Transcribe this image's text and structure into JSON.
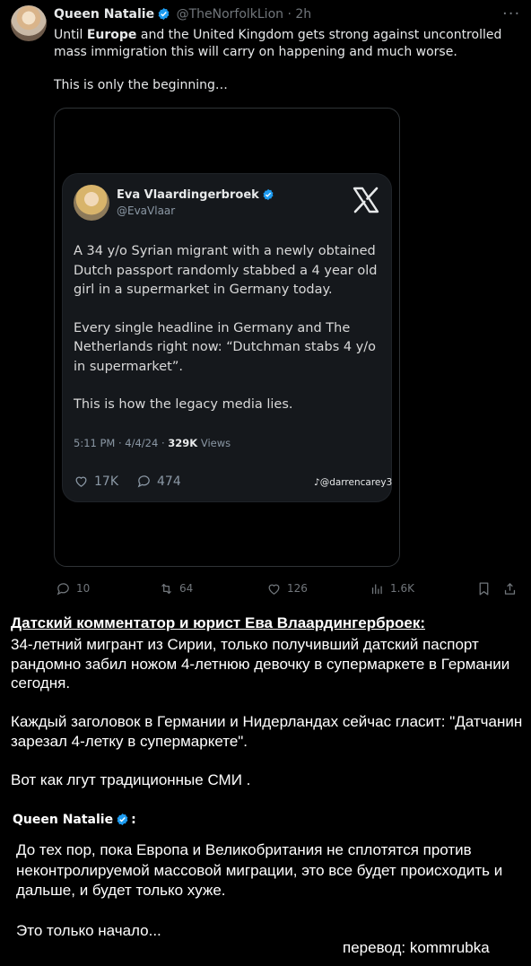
{
  "tweet": {
    "author_name": "Queen Natalie",
    "handle": "@TheNorfolkLion",
    "separator": "·",
    "time": "2h",
    "more_label": "···",
    "text_before": "Until ",
    "text_bold": "Europe",
    "text_after": " and the United Kingdom gets strong  against uncontrolled mass immigration this will carry on happening and much worse.",
    "text_line2": "This is only the beginning…"
  },
  "embedded": {
    "author_name": "Eva Vlaardingerbroek",
    "handle": "@EvaVlaar",
    "paragraph1": "A 34 y/o Syrian migrant with a newly obtained Dutch passport randomly stabbed a 4 year old girl in a supermarket in Germany today.",
    "paragraph2": "Every single headline in Germany and The Netherlands right now: “Dutchman stabs 4 y/o in supermarket”.",
    "paragraph3": "This is how the legacy media lies.",
    "meta_time": "5:11 PM · 4/4/24 · ",
    "meta_views_count": "329K",
    "meta_views_label": " Views",
    "likes": "17K",
    "replies": "474",
    "watermark": "@darrencarey3"
  },
  "actions": {
    "replies": "10",
    "retweets": "64",
    "likes": "126",
    "views": "1.6K"
  },
  "translation": {
    "title": "Датский комментатор и юрист Ева Влаардингерброек:",
    "p1": "34-летний мигрант из Сирии, только получивший датский паспорт рандомно забил ножом 4-летнюю девочку в супермаркете в Германии сегодня.",
    "p2": "Каждый заголовок в Германии и Нидерландах сейчас гласит: \"Датчанин зарезал 4-летку в супермаркете\".",
    "p3": "Вот как лгут традиционные СМИ .",
    "qn_name": "Queen Natalie",
    "qn_colon": ":",
    "p4": "До тех пор, пока Европа и Великобритания не сплотятся против неконтролируемой массовой миграции, это все будет происходить и дальше, и будет только хуже.",
    "p5": "Это только начало...",
    "credit": "перевод: kommrubka"
  },
  "colors": {
    "background": "#000000",
    "verified_blue": "#1d9bf0",
    "muted": "#71767b"
  }
}
